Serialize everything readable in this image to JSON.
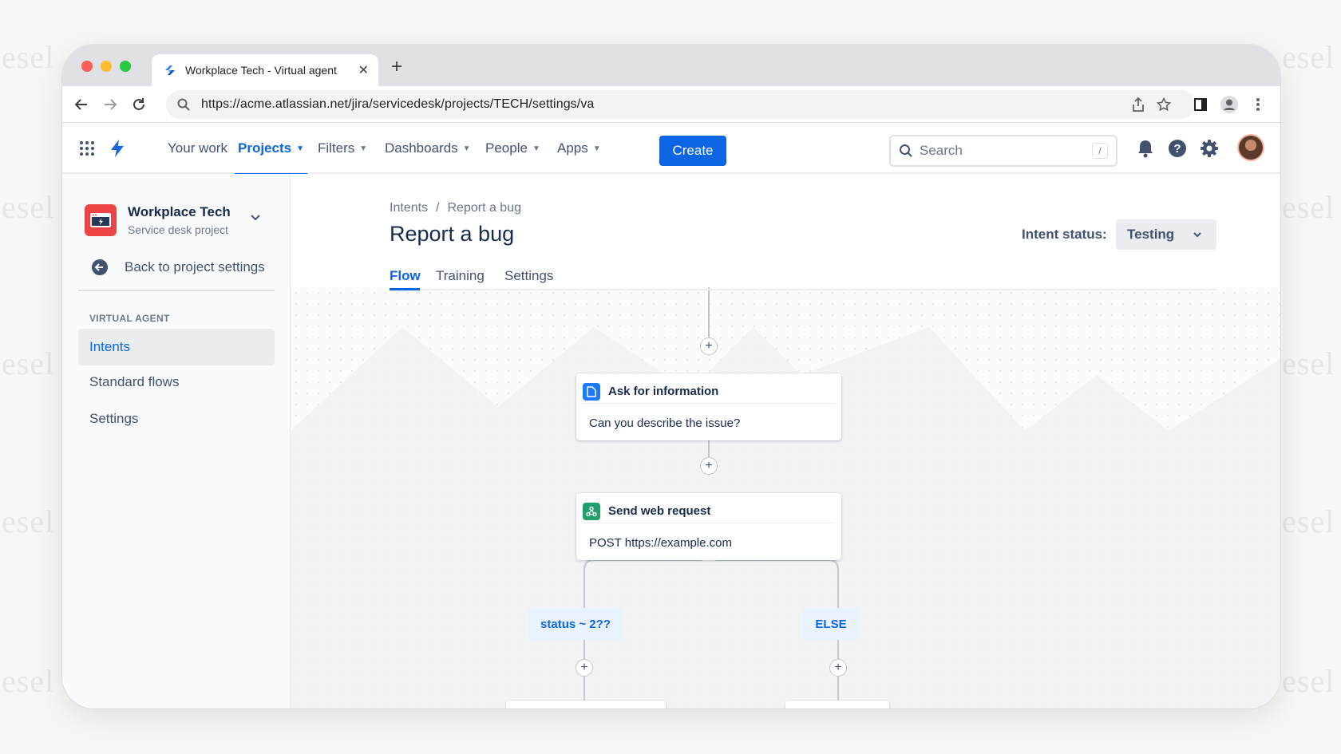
{
  "colors": {
    "accent": "#0c66e4",
    "project_icon": "#ef4444",
    "branch_bg": "#e9f2ff",
    "web_request_icon": "#22a06b"
  },
  "watermark": "esel",
  "browser": {
    "tab_title": "Workplace Tech - Virtual agent",
    "tab_close": "✕",
    "new_tab": "+",
    "url": "https://acme.atlassian.net/jira/servicedesk/projects/TECH/settings/va"
  },
  "topnav": {
    "items": [
      {
        "label": "Your work",
        "dropdown": false
      },
      {
        "label": "Projects",
        "dropdown": true,
        "active": true
      },
      {
        "label": "Filters",
        "dropdown": true
      },
      {
        "label": "Dashboards",
        "dropdown": true
      },
      {
        "label": "People",
        "dropdown": true
      },
      {
        "label": "Apps",
        "dropdown": true
      }
    ],
    "create_label": "Create",
    "search_placeholder": "Search",
    "search_shortcut": "/"
  },
  "sidebar": {
    "project_name": "Workplace Tech",
    "project_type": "Service desk project",
    "back_label": "Back to project settings",
    "section_heading": "VIRTUAL AGENT",
    "items": [
      {
        "label": "Intents",
        "active": true
      },
      {
        "label": "Standard flows"
      },
      {
        "label": "Settings"
      }
    ]
  },
  "main": {
    "breadcrumbs": [
      "Intents",
      "Report a bug"
    ],
    "breadcrumb_separator": "/",
    "title": "Report a bug",
    "status_label": "Intent status:",
    "status_value": "Testing",
    "tabs": [
      {
        "label": "Flow",
        "active": true
      },
      {
        "label": "Training"
      },
      {
        "label": "Settings"
      }
    ]
  },
  "flow": {
    "add_symbol": "+",
    "nodes": [
      {
        "icon": "document-icon",
        "title": "Ask for information",
        "body": "Can you describe the issue?"
      },
      {
        "icon": "webhook-icon",
        "title": "Send web request",
        "body": "POST https://example.com"
      }
    ],
    "branches": [
      "status ~ 2??",
      "ELSE"
    ]
  }
}
